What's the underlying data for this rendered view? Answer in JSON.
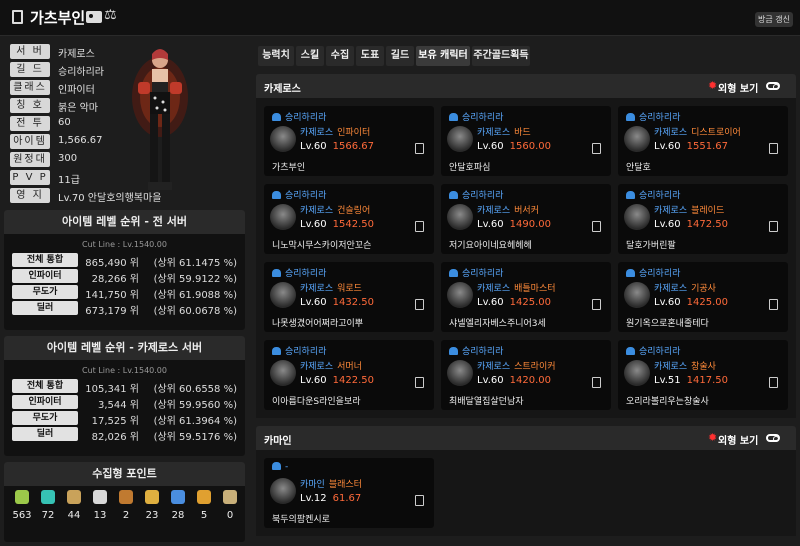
{
  "header": {
    "title": "가츠부인",
    "refresh_label": "방금 갱신"
  },
  "profile": [
    {
      "label": "서 버",
      "value": "카제로스"
    },
    {
      "label": "길 드",
      "value": "승리하리라"
    },
    {
      "label": "클래스",
      "value": "인파이터"
    },
    {
      "label": "칭 호",
      "value": "붉은 악마"
    },
    {
      "label": "전 투",
      "value": "60"
    },
    {
      "label": "아이템",
      "value": "1,566.67"
    },
    {
      "label": "원정대",
      "value": "300"
    },
    {
      "label": "P V P",
      "value": "11급"
    },
    {
      "label": "영 지",
      "value": "Lv.70 안달호의행복마을"
    }
  ],
  "rank_all": {
    "title": "아이템 레벨 순위 - 전 서버",
    "cutline": "Cut Line : Lv.1540.00",
    "rows": [
      {
        "label": "전체 통합",
        "rank": "865,490 위",
        "pct": "(상위  61.1475 %)"
      },
      {
        "label": "인파이터",
        "rank": "28,266 위",
        "pct": "(상위  59.9122 %)"
      },
      {
        "label": "무도가",
        "rank": "141,750 위",
        "pct": "(상위  61.9088 %)"
      },
      {
        "label": "딜러",
        "rank": "673,179 위",
        "pct": "(상위  60.0678 %)"
      }
    ]
  },
  "rank_server": {
    "title": "아이템 레벨 순위 - 카제로스 서버",
    "cutline": "Cut Line : Lv.1540.00",
    "rows": [
      {
        "label": "전체 통합",
        "rank": "105,341 위",
        "pct": "(상위  60.6558 %)"
      },
      {
        "label": "인파이터",
        "rank": "3,544 위",
        "pct": "(상위  59.9560 %)"
      },
      {
        "label": "무도가",
        "rank": "17,525 위",
        "pct": "(상위  61.3964 %)"
      },
      {
        "label": "딜러",
        "rank": "82,026 위",
        "pct": "(상위  59.5176 %)"
      }
    ]
  },
  "collection": {
    "title": "수집형 포인트",
    "items": [
      {
        "icon": "mokoko-seed-icon",
        "count": "563",
        "color": "#9cc94a"
      },
      {
        "icon": "island-heart-icon",
        "count": "72",
        "color": "#36c2b4"
      },
      {
        "icon": "great-art-icon",
        "count": "44",
        "color": "#c9a25a"
      },
      {
        "icon": "giant-heart-icon",
        "count": "13",
        "color": "#d8d8d8"
      },
      {
        "icon": "ignea-token-icon",
        "count": "2",
        "color": "#c07a30"
      },
      {
        "icon": "voyage-item-icon",
        "count": "23",
        "color": "#e0b040"
      },
      {
        "icon": "world-tree-leaf-icon",
        "count": "28",
        "color": "#4a8ee0"
      },
      {
        "icon": "orpheus-star-icon",
        "count": "5",
        "color": "#e0a030"
      },
      {
        "icon": "orgel-icon",
        "count": "0",
        "color": "#c9b07a"
      }
    ]
  },
  "tabs": [
    {
      "label": "능력치"
    },
    {
      "label": "스킬"
    },
    {
      "label": "수집"
    },
    {
      "label": "도표"
    },
    {
      "label": "길드"
    },
    {
      "label": "보유 캐릭터"
    },
    {
      "label": "주간골드획득"
    }
  ],
  "look_label": "외형 보기",
  "servers": [
    {
      "name": "카제로스",
      "characters": [
        {
          "guild": "승리하리라",
          "server": "카제로스",
          "cls": "인파이터",
          "level": "Lv.60",
          "ilvl": "1566.67",
          "name": "가츠부인"
        },
        {
          "guild": "승리하리라",
          "server": "카제로스",
          "cls": "바드",
          "level": "Lv.60",
          "ilvl": "1560.00",
          "name": "안달호파심"
        },
        {
          "guild": "승리하리라",
          "server": "카제로스",
          "cls": "디스트로이어",
          "level": "Lv.60",
          "ilvl": "1551.67",
          "name": "안달호"
        },
        {
          "guild": "승리하리라",
          "server": "카제로스",
          "cls": "건슬링어",
          "level": "Lv.60",
          "ilvl": "1542.50",
          "name": "니노막시무스카이저안꼬슨"
        },
        {
          "guild": "승리하리라",
          "server": "카제로스",
          "cls": "버서커",
          "level": "Lv.60",
          "ilvl": "1490.00",
          "name": "저기요아이네요헤헤헤"
        },
        {
          "guild": "승리하리라",
          "server": "카제로스",
          "cls": "블레이드",
          "level": "Lv.60",
          "ilvl": "1472.50",
          "name": "달호가버린팔"
        },
        {
          "guild": "승리하리라",
          "server": "카제로스",
          "cls": "워로드",
          "level": "Lv.60",
          "ilvl": "1432.50",
          "name": "나못생겼어어쩌라고이뿌"
        },
        {
          "guild": "승리하리라",
          "server": "카제로스",
          "cls": "배틀마스터",
          "level": "Lv.60",
          "ilvl": "1425.00",
          "name": "샤넬엘리자베스주니어3세"
        },
        {
          "guild": "승리하리라",
          "server": "카제로스",
          "cls": "기공사",
          "level": "Lv.60",
          "ilvl": "1425.00",
          "name": "원기옥으로혼내줄테다"
        },
        {
          "guild": "승리하리라",
          "server": "카제로스",
          "cls": "서머너",
          "level": "Lv.60",
          "ilvl": "1422.50",
          "name": "이아름다운S라인을보라"
        },
        {
          "guild": "승리하리라",
          "server": "카제로스",
          "cls": "스트라이커",
          "level": "Lv.60",
          "ilvl": "1420.00",
          "name": "최배달열집살던남자"
        },
        {
          "guild": "승리하리라",
          "server": "카제로스",
          "cls": "창술사",
          "level": "Lv.51",
          "ilvl": "1417.50",
          "name": "오리라볼리우는창술사"
        }
      ]
    },
    {
      "name": "카마인",
      "characters": [
        {
          "guild": "-",
          "server": "카마인",
          "cls": "블래스터",
          "level": "Lv.12",
          "ilvl": "61.67",
          "name": "북두의팜켄시로"
        }
      ]
    }
  ]
}
